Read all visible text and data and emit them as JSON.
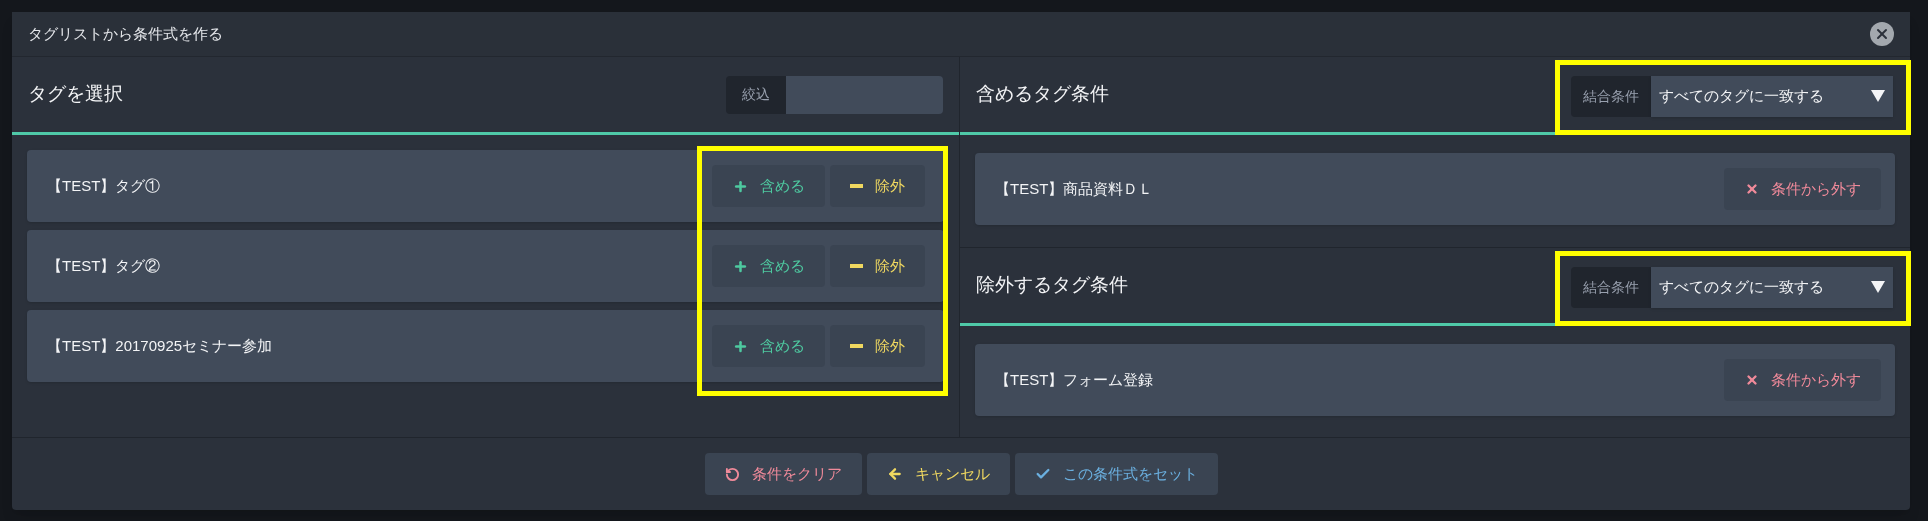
{
  "dialog": {
    "title": "タグリストから条件式を作る"
  },
  "select_panel": {
    "heading": "タグを選択",
    "filter": {
      "label": "絞込"
    },
    "actions_highlighted": true,
    "tags": [
      {
        "name": "【TEST】タグ①",
        "include": "含める",
        "exclude": "除外"
      },
      {
        "name": "【TEST】タグ②",
        "include": "含める",
        "exclude": "除外"
      },
      {
        "name": "【TEST】20170925セミナー参加",
        "include": "含める",
        "exclude": "除外"
      }
    ]
  },
  "condition_groups": [
    {
      "heading": "含めるタグ条件",
      "combine_label": "結合条件",
      "combine_value": "すべてのタグに一致する",
      "highlighted": true,
      "tags": [
        {
          "name": "【TEST】商品資料ＤＬ",
          "remove": "条件から外す"
        }
      ]
    },
    {
      "heading": "除外するタグ条件",
      "combine_label": "結合条件",
      "combine_value": "すべてのタグに一致する",
      "highlighted": true,
      "tags": [
        {
          "name": "【TEST】フォーム登録",
          "remove": "条件から外す"
        }
      ]
    }
  ],
  "footer_buttons": [
    {
      "kind": "clear",
      "label": "条件をクリア"
    },
    {
      "kind": "cancel",
      "label": "キャンセル"
    },
    {
      "kind": "apply",
      "label": "この条件式をセット"
    }
  ]
}
